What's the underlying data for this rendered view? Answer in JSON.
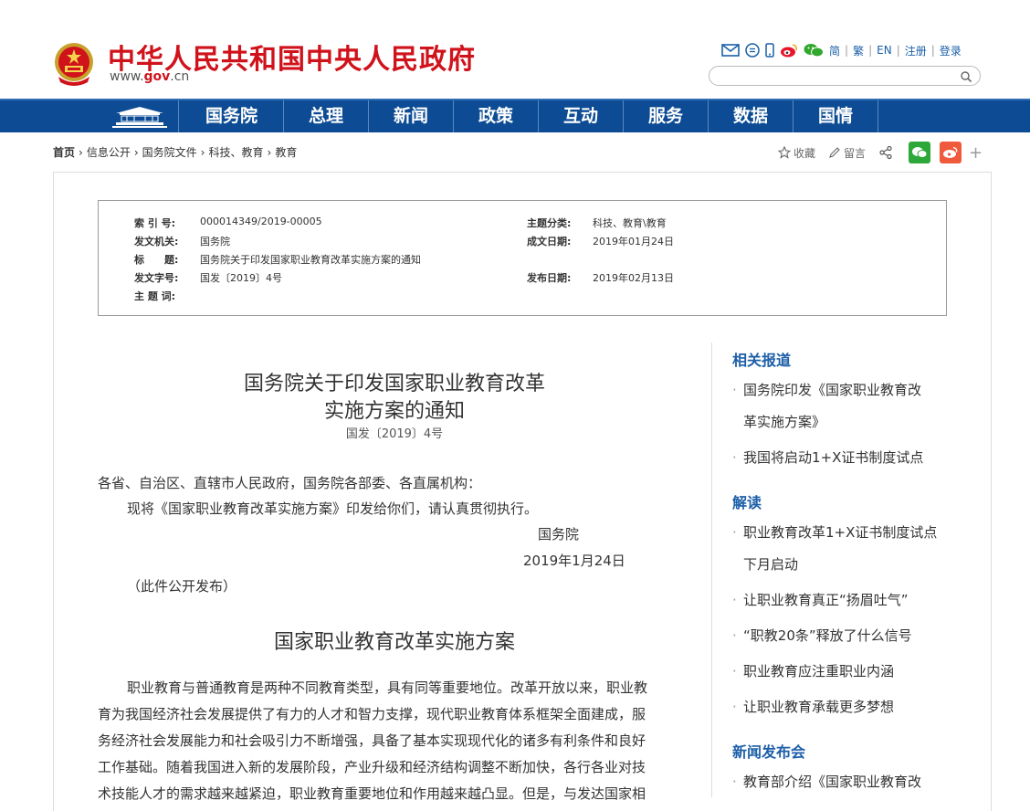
{
  "header": {
    "site_title": "中华人民共和国中央人民政府",
    "domain_prefix": "www.",
    "domain_mid": "gov",
    "domain_suffix": ".cn",
    "links": [
      "简",
      "繁",
      "EN",
      "注册",
      "登录"
    ],
    "search_placeholder": ""
  },
  "nav": {
    "items": [
      "国务院",
      "总理",
      "新闻",
      "政策",
      "互动",
      "服务",
      "数据",
      "国情"
    ]
  },
  "breadcrumb": [
    "首页",
    "信息公开",
    "国务院文件",
    "科技、教育",
    "教育"
  ],
  "share": {
    "favorite": "收藏",
    "message": "留言"
  },
  "meta": {
    "index_label": "索 引 号:",
    "index_value": "000014349/2019-00005",
    "topic_label": "主题分类:",
    "topic_value": "科技、教育\\教育",
    "issuer_label": "发文机关:",
    "issuer_value": "国务院",
    "date_label": "成文日期:",
    "date_value": "2019年01月24日",
    "title_label": "标　　题:",
    "title_value": "国务院关于印发国家职业教育改革实施方案的通知",
    "docno_label": "发文字号:",
    "docno_value": "国发〔2019〕4号",
    "pub_label": "发布日期:",
    "pub_value": "2019年02月13日",
    "keywords_label": "主 题 词:"
  },
  "article": {
    "title_line1": "国务院关于印发国家职业教育改革",
    "title_line2": "实施方案的通知",
    "doc_number": "国发〔2019〕4号",
    "addressee": "各省、自治区、直辖市人民政府，国务院各部委、各直属机构：",
    "instruction": "现将《国家职业教育改革实施方案》印发给你们，请认真贯彻执行。",
    "signature": "国务院",
    "sign_date": "2019年1月24日",
    "public_note": "（此件公开发布）",
    "plan_title": "国家职业教育改革实施方案",
    "body_lines": [
      "职业教育与普通教育是两种不同教育类型，具有同等重要地位。改革开放以来，职业教",
      "育为我国经济社会发展提供了有力的人才和智力支撑，现代职业教育体系框架全面建成，服",
      "务经济社会发展能力和社会吸引力不断增强，具备了基本实现现代化的诸多有利条件和良好",
      "工作基础。随着我国进入新的发展阶段，产业升级和经济结构调整不断加快，各行各业对技",
      "术技能人才的需求越来越紧迫，职业教育重要地位和作用越来越凸显。但是，与发达国家相"
    ]
  },
  "sidebar": {
    "related_heading": "相关报道",
    "related": [
      [
        "国务院印发《国家职业教育改",
        "革实施方案》"
      ],
      [
        "我国将启动1+X证书制度试点"
      ]
    ],
    "interp_heading": "解读",
    "interp": [
      [
        "职业教育改革1+X证书制度试点",
        "下月启动"
      ],
      [
        "让职业教育真正“扬眉吐气”"
      ],
      [
        "“职教20条”释放了什么信号"
      ],
      [
        "职业教育应注重职业内涵"
      ],
      [
        "让职业教育承载更多梦想"
      ]
    ],
    "press_heading": "新闻发布会",
    "press": [
      [
        "教育部介绍《国家职业教育改"
      ]
    ]
  }
}
